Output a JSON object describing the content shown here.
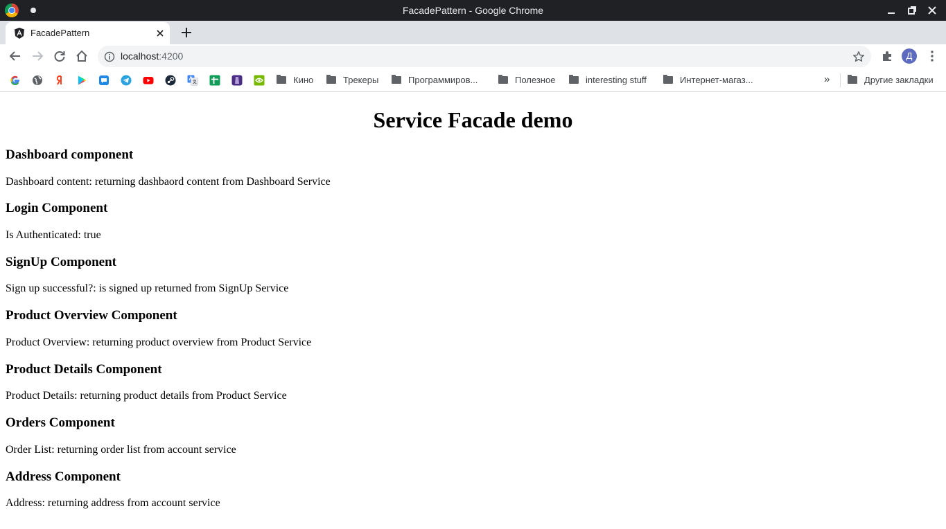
{
  "window": {
    "title": "FacadePattern - Google Chrome"
  },
  "tab": {
    "title": "FacadePattern"
  },
  "address_bar": {
    "host": "localhost",
    "port": ":4200"
  },
  "profile": {
    "initial": "Д"
  },
  "bookmarks": {
    "favicons": [
      "google-icon",
      "globe-icon",
      "yandex-icon",
      "play-store-icon",
      "chat-icon",
      "telegram-icon",
      "youtube-icon",
      "steam-icon",
      "translate-icon",
      "sheets-icon",
      "app-icon",
      "nvidia-icon"
    ],
    "folders": [
      "Кино",
      "Трекеры",
      "Программиров...",
      "Полезное",
      "interesting stuff",
      "Интернет-магаз..."
    ],
    "other": "Другие закладки"
  },
  "page": {
    "title": "Service Facade demo",
    "sections": [
      {
        "heading": "Dashboard component",
        "text": "Dashboard content: returning dashbaord content from Dashboard Service"
      },
      {
        "heading": "Login Component",
        "text": "Is Authenticated: true"
      },
      {
        "heading": "SignUp Component",
        "text": "Sign up successful?: is signed up returned from SignUp Service"
      },
      {
        "heading": "Product Overview Component",
        "text": "Product Overview: returning product overview from Product Service"
      },
      {
        "heading": "Product Details Component",
        "text": "Product Details: returning product details from Product Service"
      },
      {
        "heading": "Orders Component",
        "text": "Order List: returning order list from account service"
      },
      {
        "heading": "Address Component",
        "text": "Address: returning address from account service"
      }
    ]
  }
}
